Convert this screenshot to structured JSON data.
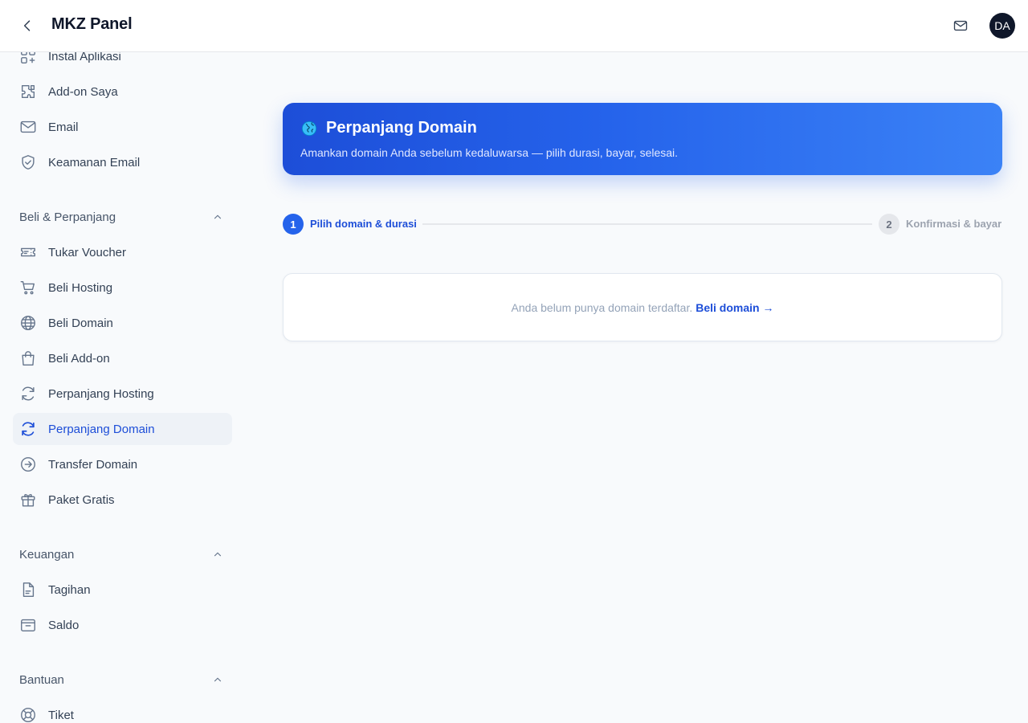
{
  "header": {
    "title": "MKZ Panel",
    "avatar_initials": "DA",
    "icons": {
      "back": "chevron-left-icon",
      "mail": "mail-icon"
    }
  },
  "sidebar": {
    "items_top": [
      {
        "label": "Instal Aplikasi",
        "icon": "apps-plus-icon"
      },
      {
        "label": "Add-on Saya",
        "icon": "puzzle-icon"
      },
      {
        "label": "Email",
        "icon": "mail-icon"
      },
      {
        "label": "Keamanan Email",
        "icon": "shield-check-icon"
      }
    ],
    "sections": [
      {
        "title": "Beli & Perpanjang",
        "items": [
          {
            "label": "Tukar Voucher",
            "icon": "ticket-icon"
          },
          {
            "label": "Beli Hosting",
            "icon": "cart-icon"
          },
          {
            "label": "Beli Domain",
            "icon": "globe-icon"
          },
          {
            "label": "Beli Add-on",
            "icon": "shopping-bag-icon"
          },
          {
            "label": "Perpanjang Hosting",
            "icon": "refresh-icon"
          },
          {
            "label": "Perpanjang Domain",
            "icon": "refresh-icon",
            "active": true
          },
          {
            "label": "Transfer Domain",
            "icon": "arrow-circle-right-icon"
          },
          {
            "label": "Paket Gratis",
            "icon": "gift-icon"
          }
        ]
      },
      {
        "title": "Keuangan",
        "items": [
          {
            "label": "Tagihan",
            "icon": "document-icon"
          },
          {
            "label": "Saldo",
            "icon": "wallet-icon"
          }
        ]
      },
      {
        "title": "Bantuan",
        "items": [
          {
            "label": "Tiket",
            "icon": "lifebuoy-icon"
          }
        ]
      }
    ]
  },
  "hero": {
    "icon": "globe-emoji-icon",
    "title": "Perpanjang Domain",
    "subtitle": "Amankan domain Anda sebelum kedaluwarsa — pilih durasi, bayar, selesai."
  },
  "stepper": {
    "steps": [
      {
        "number": "1",
        "label": "Pilih domain & durasi",
        "active": true
      },
      {
        "number": "2",
        "label": "Konfirmasi & bayar",
        "active": false
      }
    ]
  },
  "empty_state": {
    "text": "Anda belum punya domain terdaftar.",
    "link": "Beli domain →"
  },
  "colors": {
    "accent": "#2563eb",
    "accent_dark": "#1d4ed8",
    "background": "#f8fafc",
    "header": "#0f172a"
  }
}
